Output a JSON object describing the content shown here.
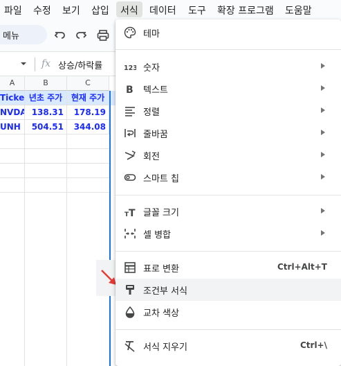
{
  "menubar": {
    "items": [
      "파일",
      "수정",
      "보기",
      "삽입",
      "서식",
      "데이터",
      "도구",
      "확장 프로그램",
      "도움말"
    ],
    "active": "서식"
  },
  "toolbar": {
    "menu_search_label": "메뉴",
    "icons": [
      "undo-icon",
      "redo-icon",
      "print-icon"
    ]
  },
  "formula_bar": {
    "fx_label": "fx",
    "content": "상승/하락률"
  },
  "grid": {
    "columns": [
      "A",
      "B",
      "C"
    ],
    "header_row": [
      "Ticker",
      "년초 주가",
      "현재 주가"
    ],
    "rows": [
      [
        "NVDA",
        "138.31",
        "178.19"
      ],
      [
        "UNH",
        "504.51",
        "344.08"
      ]
    ],
    "colors": {
      "header_bg": "#d9eaff",
      "text_blue": "#1a2bff",
      "selection": "#1a73e8"
    }
  },
  "format_menu": {
    "items": [
      {
        "label": "테마",
        "icon": "palette-icon",
        "submenu": false,
        "shortcut": ""
      },
      {
        "label": "숫자",
        "icon": "number-format-icon",
        "submenu": true,
        "shortcut": ""
      },
      {
        "label": "텍스트",
        "icon": "bold-icon",
        "submenu": true,
        "shortcut": ""
      },
      {
        "label": "정렬",
        "icon": "align-icon",
        "submenu": true,
        "shortcut": ""
      },
      {
        "label": "줄바꿈",
        "icon": "text-wrap-icon",
        "submenu": true,
        "shortcut": ""
      },
      {
        "label": "회전",
        "icon": "text-rotate-icon",
        "submenu": true,
        "shortcut": ""
      },
      {
        "label": "스마트 칩",
        "icon": "smart-chip-icon",
        "submenu": true,
        "shortcut": ""
      },
      {
        "label": "글꼴 크기",
        "icon": "font-size-icon",
        "submenu": true,
        "shortcut": ""
      },
      {
        "label": "셀 병합",
        "icon": "merge-cells-icon",
        "submenu": true,
        "shortcut": ""
      },
      {
        "label": "표로 변환",
        "icon": "table-icon",
        "submenu": false,
        "shortcut": "Ctrl+Alt+T"
      },
      {
        "label": "조건부 서식",
        "icon": "paint-roller-icon",
        "submenu": false,
        "shortcut": "",
        "highlighted": true
      },
      {
        "label": "교차 색상",
        "icon": "alternating-colors-icon",
        "submenu": false,
        "shortcut": ""
      },
      {
        "label": "서식 지우기",
        "icon": "clear-format-icon",
        "submenu": false,
        "shortcut": "Ctrl+\\"
      }
    ]
  }
}
